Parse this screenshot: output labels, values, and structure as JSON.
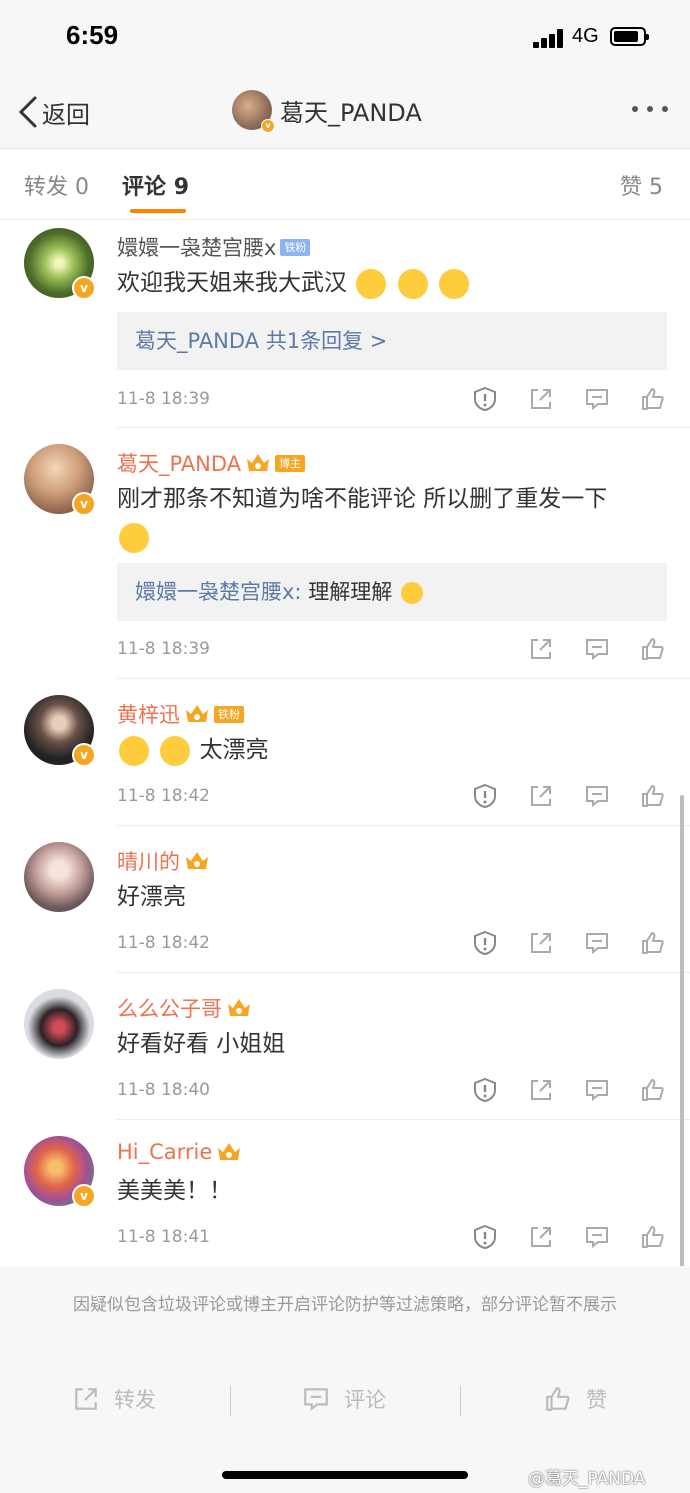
{
  "status_bar": {
    "time": "6:59",
    "network": "4G"
  },
  "nav": {
    "back_label": "返回",
    "title": "葛天_PANDA"
  },
  "tabs": [
    {
      "label": "转发",
      "count": "0"
    },
    {
      "label": "评论",
      "count": "9"
    },
    {
      "label": "赞",
      "count": "5"
    }
  ],
  "comments": [
    {
      "name": "嬛嬛一袅楚宫腰x",
      "badge": "铁粉",
      "text": "欢迎我天姐来我大武汉",
      "reply_summary": "葛天_PANDA  共1条回复 >",
      "time": "11-8 18:39"
    },
    {
      "name": "葛天_PANDA",
      "badge": "博主",
      "text": "刚才那条不知道为啥不能评论 所以删了重发一下",
      "reply_author": "嬛嬛一袅楚宫腰x:",
      "reply_text": "理解理解",
      "time": "11-8 18:39"
    },
    {
      "name": "黄梓迅",
      "badge": "铁粉",
      "text": "太漂亮",
      "time": "11-8 18:42"
    },
    {
      "name": "晴川的",
      "text": "好漂亮",
      "time": "11-8 18:42"
    },
    {
      "name": "么么公子哥",
      "text": "好看好看 小姐姐",
      "time": "11-8 18:40"
    },
    {
      "name": "Hi_Carrie",
      "text": "美美美！！",
      "time": "11-8 18:41"
    }
  ],
  "footer_note": "因疑似包含垃圾评论或博主开启评论防护等过滤策略，部分评论暂不展示",
  "bottom_bar": {
    "repost": "转发",
    "comment": "评论",
    "like": "赞"
  },
  "watermark": "@葛天_PANDA",
  "colors": {
    "accent": "#ff8200",
    "username": "#eb7350",
    "link": "#5d7aa6",
    "vip_badge": "#f5a623"
  }
}
